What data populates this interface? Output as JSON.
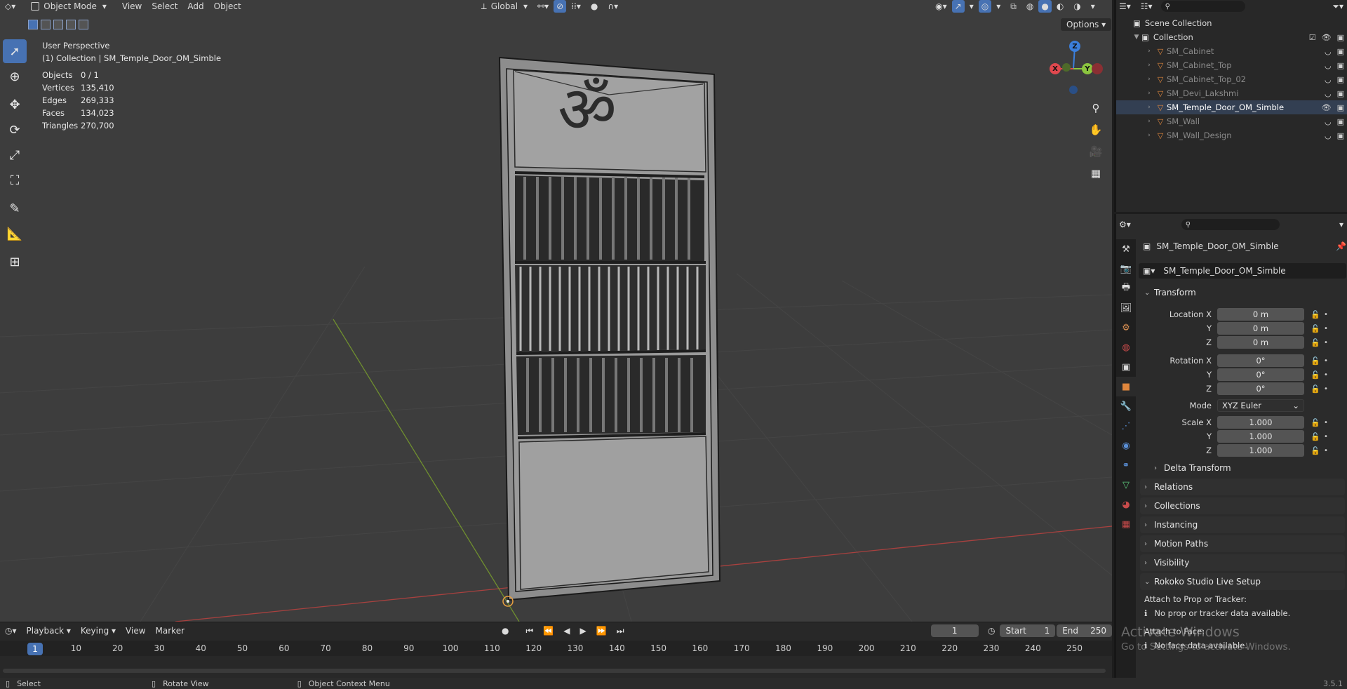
{
  "viewport": {
    "mode": "Object Mode",
    "menus": [
      "View",
      "Select",
      "Add",
      "Object"
    ],
    "orientation": "Global",
    "options_label": "Options",
    "perspective": "User Perspective",
    "collection_line": "(1) Collection | SM_Temple_Door_OM_Simble",
    "stats": [
      {
        "label": "Objects",
        "value": "0 / 1"
      },
      {
        "label": "Vertices",
        "value": "135,410"
      },
      {
        "label": "Edges",
        "value": "269,333"
      },
      {
        "label": "Faces",
        "value": "134,023"
      },
      {
        "label": "Triangles",
        "value": "270,700"
      }
    ],
    "gizmo": {
      "x": "X",
      "y": "Y",
      "z": "Z"
    },
    "door_symbol": "ॐ"
  },
  "timeline": {
    "menus": [
      "Playback",
      "Keying",
      "View",
      "Marker"
    ],
    "current_frame": "1",
    "start_label": "Start",
    "start_value": "1",
    "end_label": "End",
    "end_value": "250",
    "ticks": [
      "1",
      "10",
      "20",
      "30",
      "40",
      "50",
      "60",
      "70",
      "80",
      "90",
      "100",
      "110",
      "120",
      "130",
      "140",
      "150",
      "160",
      "170",
      "180",
      "190",
      "200",
      "210",
      "220",
      "230",
      "240",
      "250"
    ]
  },
  "statusbar": {
    "select": "Select",
    "rotate": "Rotate View",
    "context": "Object Context Menu",
    "version": "3.5.1"
  },
  "outliner": {
    "scene": "Scene Collection",
    "collection": "Collection",
    "items": [
      {
        "name": "SM_Cabinet"
      },
      {
        "name": "SM_Cabinet_Top"
      },
      {
        "name": "SM_Cabinet_Top_02"
      },
      {
        "name": "SM_Devi_Lakshmi"
      },
      {
        "name": "SM_Temple_Door_OM_Simble"
      },
      {
        "name": "SM_Wall"
      },
      {
        "name": "SM_Wall_Design"
      }
    ]
  },
  "properties": {
    "object_title": "SM_Temple_Door_OM_Simble",
    "object_name": "SM_Temple_Door_OM_Simble",
    "transform_label": "Transform",
    "location": {
      "label": "Location X",
      "x": "0 m",
      "y": "0 m",
      "z": "0 m"
    },
    "rotation": {
      "label": "Rotation X",
      "x": "0°",
      "y": "0°",
      "z": "0°"
    },
    "mode_label": "Mode",
    "mode_value": "XYZ Euler",
    "scale": {
      "label": "Scale X",
      "x": "1.000",
      "y": "1.000",
      "z": "1.000"
    },
    "axis_y": "Y",
    "axis_z": "Z",
    "delta": "Delta Transform",
    "panels": [
      "Relations",
      "Collections",
      "Instancing",
      "Motion Paths",
      "Visibility"
    ],
    "rokoko": "Rokoko Studio Live Setup",
    "attach_prop": "Attach to Prop or Tracker:",
    "no_prop": "No prop or tracker data available.",
    "attach_face": "Attach to Face:",
    "no_face": "No face data available."
  },
  "watermark": {
    "line1": "Activate Windows",
    "line2": "Go to Settings to activate Windows."
  },
  "colors": {
    "accent": "#4772b3",
    "axis_x": "#e0484e",
    "axis_y": "#8bc53f",
    "axis_z": "#3b7fdc",
    "mesh": "#e0873d"
  }
}
